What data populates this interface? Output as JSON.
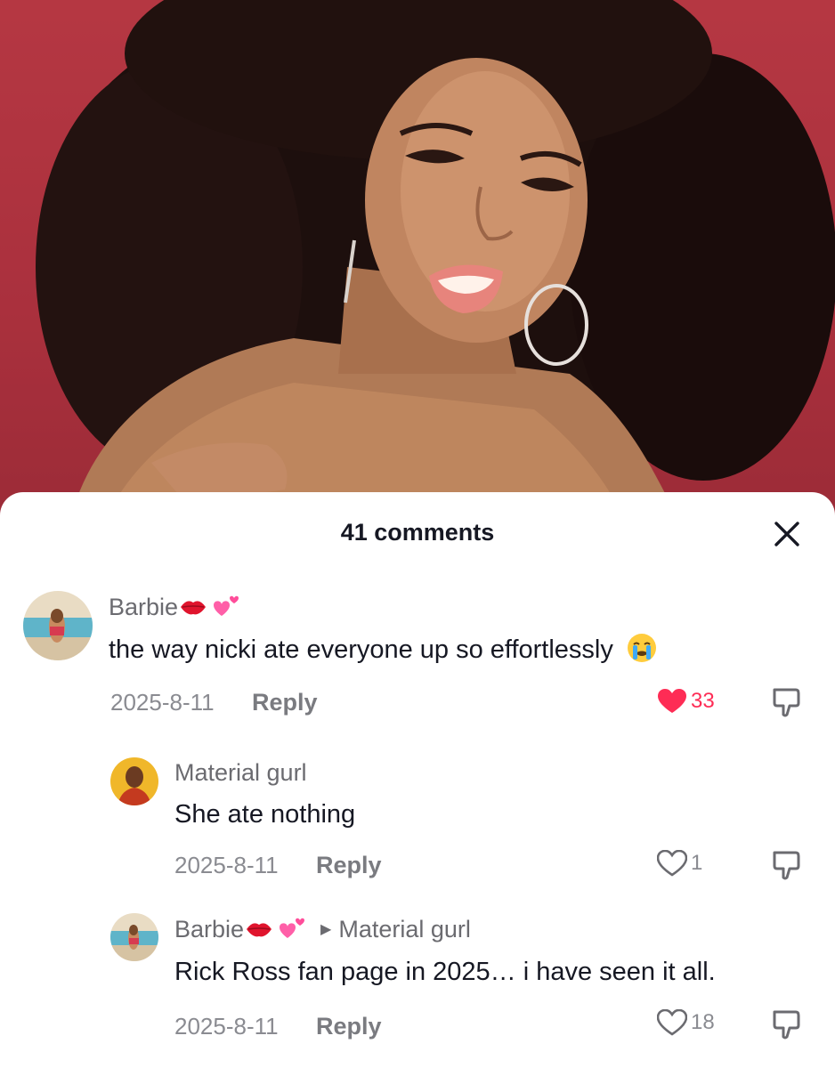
{
  "sheet": {
    "title": "41 comments"
  },
  "comments": [
    {
      "username": "Barbie",
      "text": "the way nicki ate everyone up so effortlessly",
      "date": "2025-8-11",
      "reply_label": "Reply",
      "likes": "33",
      "liked": true
    },
    {
      "username": "Material gurl",
      "text": "She ate nothing",
      "date": "2025-8-11",
      "reply_label": "Reply",
      "likes": "1",
      "liked": false
    },
    {
      "username": "Barbie",
      "reply_to": "Material gurl",
      "text": "Rick Ross fan page in 2025… i have seen it all.",
      "date": "2025-8-11",
      "reply_label": "Reply",
      "likes": "18",
      "liked": false
    }
  ],
  "icons": {
    "close": "close-icon",
    "heart": "heart-icon",
    "dislike": "dislike-icon",
    "kiss_lips": "kiss-lips-emoji",
    "two_hearts": "two-hearts-emoji",
    "crying": "crying-emoji"
  },
  "colors": {
    "like_active": "#fe2c55",
    "text_primary": "#161823",
    "text_secondary": "#8a8b91"
  }
}
